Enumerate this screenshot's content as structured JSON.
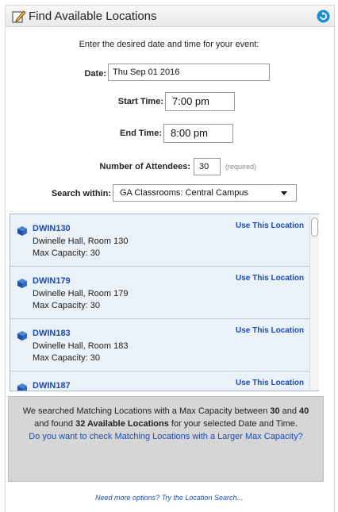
{
  "header": {
    "title": "Find Available Locations",
    "edit_icon": "edit-icon",
    "refresh_icon": "refresh-icon"
  },
  "intro": "Enter the desired date and time for your event:",
  "form": {
    "date_label": "Date:",
    "date_value": "Thu Sep 01 2016",
    "start_label": "Start Time:",
    "start_value": "7:00 pm",
    "end_label": "End Time:",
    "end_value": "8:00 pm",
    "attendees_label": "Number of Attendees:",
    "attendees_value": "30",
    "attendees_note": "(required)",
    "search_label": "Search within:",
    "search_value": "GA Classrooms: Central Campus"
  },
  "results": [
    {
      "name": "DWIN130",
      "room": "Dwinelle Hall, Room 130",
      "capacity": "Max Capacity: 30",
      "action": "Use This Location"
    },
    {
      "name": "DWIN179",
      "room": "Dwinelle Hall, Room 179",
      "capacity": "Max Capacity: 30",
      "action": "Use This Location"
    },
    {
      "name": "DWIN183",
      "room": "Dwinelle Hall, Room 183",
      "capacity": "Max Capacity: 30",
      "action": "Use This Location"
    },
    {
      "name": "DWIN187",
      "room": "",
      "capacity": "",
      "action": "Use This Location"
    }
  ],
  "summary": {
    "t1": "We searched Matching Locations with a Max Capacity between ",
    "min": "30",
    "t2": " and ",
    "max": "40",
    "t3": " and found ",
    "found": "32 Available Locations",
    "t4": " for your selected Date and Time.",
    "link": "Do you want to check Matching Locations with a Larger Max Capacity?"
  },
  "more_options": "Need more options? Try the Location Search...",
  "colors": {
    "link": "#1a4bb8",
    "accent": "#1a8fd6",
    "list_bg": "#eaf1f7"
  }
}
